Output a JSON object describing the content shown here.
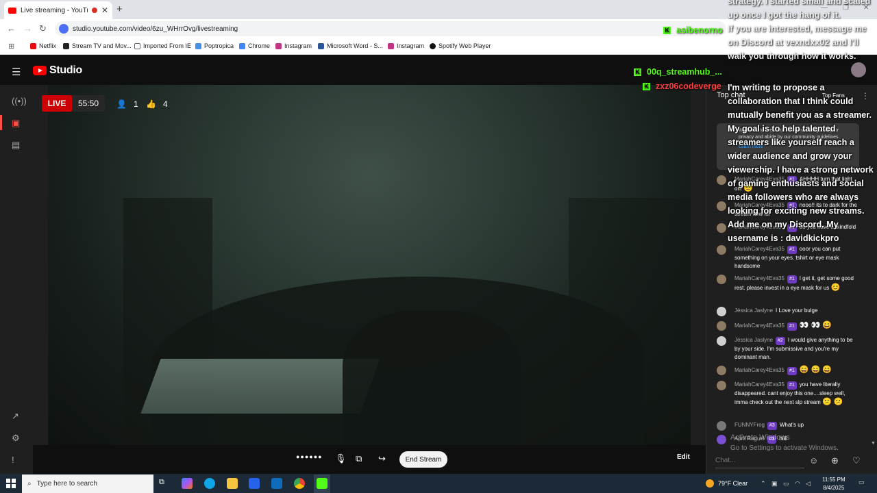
{
  "browser": {
    "tab_title": "Live streaming - YouTube Studio",
    "url": "studio.youtube.com/video/6zu_WHrrOvg/livestreaming",
    "bookmarks": [
      {
        "label": "Netflix",
        "icon": "netflix-icon",
        "color": "#e50914"
      },
      {
        "label": "Stream TV and Mov...",
        "icon": "hulu-icon",
        "color": "#1ce783"
      },
      {
        "label": "Imported From IE",
        "icon": "folder-icon",
        "color": "#5f6368"
      },
      {
        "label": "Poptropica",
        "icon": "poptropica-icon",
        "color": "#4a90e2"
      },
      {
        "label": "Chrome",
        "icon": "google-icon",
        "color": "#4285f4"
      },
      {
        "label": "Instagram",
        "icon": "instagram-icon",
        "color": "#c13584"
      },
      {
        "label": "Microsoft Word - S...",
        "icon": "word-icon",
        "color": "#2b579a"
      },
      {
        "label": "Instagram",
        "icon": "instagram-icon",
        "color": "#c13584"
      },
      {
        "label": "Spotify Web Player",
        "icon": "spotify-icon",
        "color": "#1db954"
      }
    ]
  },
  "studio": {
    "logo_text": "Studio",
    "live_label": "LIVE",
    "elapsed": "55:50",
    "viewers": "1",
    "likes": "4",
    "end_stream_label": "End Stream",
    "edit_label": "Edit",
    "dots": "●●●●●●"
  },
  "overlay": {
    "kick_header_users": [
      {
        "name": "asibenorno",
        "color": "#53fc18"
      },
      {
        "name": "00q_streamhub_...",
        "color": "#53fc18"
      },
      {
        "name": "zxz06codeverge",
        "color": "#ff3b3b"
      }
    ],
    "top_text_lines": [
      "strategy. I started small and scaled",
      "up once I got the hang of it.",
      "If you are interested, message me",
      "on Discord at vexndxx02 and I'll",
      "walk you through how it works."
    ],
    "message": "I'm writing to propose a collaboration that I think could mutually benefit you as a streamer. My goal is to help talented streamers like yourself reach a wider audience and grow your viewership. I have a strong network of gaming enthusiasts and social media followers who are always looking for exciting new streams. Add me on my Discord. My username is : davidkickpro"
  },
  "chat": {
    "mode_label": "Top chat",
    "top_fans_label": "Top Fans",
    "welcome": "Welcome to live chat! Remember to guard your privacy and abide by our community guidelines.",
    "learn_more": "Learn more",
    "messages": [
      {
        "name": "MariahCarey4Eva35",
        "badge": "#1",
        "text": "AHHHH turn that light on!",
        "emoji": "😑"
      },
      {
        "name": "MariahCarey4Eva35",
        "badge": "#1",
        "text": "nooo!! its to dark for the stream now lol",
        "emoji": ""
      },
      {
        "name": "MariahCarey4Eva35",
        "badge": "#1",
        "text": "do you have a blindfold",
        "emoji": ""
      },
      {
        "name": "MariahCarey4Eva35",
        "badge": "#1",
        "text": "ooor you can put something on your eyes. tshirt or eye mask handsome",
        "emoji": ""
      },
      {
        "name": "MariahCarey4Eva35",
        "badge": "#1",
        "text": "I get it, get some good rest. please invest in a eye mask for us",
        "emoji": "😊"
      },
      {
        "name": "Jéssica Jaslyne",
        "badge": "",
        "text": "I Love your bulge",
        "emoji": ""
      },
      {
        "name": "MariahCarey4Eva35",
        "badge": "#1",
        "text": "",
        "emoji": "👀 👀 😄"
      },
      {
        "name": "Jéssica Jaslyne",
        "badge": "#2",
        "text": "I would give anything to be by your side. I'm submissive and you're my dominant man.",
        "emoji": ""
      },
      {
        "name": "MariahCarey4Eva35",
        "badge": "#1",
        "text": "",
        "emoji": "😄 😄 😄"
      },
      {
        "name": "MariahCarey4Eva35",
        "badge": "#1",
        "text": "you have literally disappeared. cant enjoy this one....sleep well, imma check out the next slp stream",
        "emoji": "😕 😕"
      },
      {
        "name": "FUNNYFrog",
        "badge": "#3",
        "text": "What's up",
        "emoji": ""
      },
      {
        "name": "April Raguel",
        "badge": "#3",
        "text": "hiiii",
        "emoji": ""
      }
    ],
    "input_placeholder": "Chat..."
  },
  "windows": {
    "watermark_title": "Activate Windows",
    "watermark_sub": "Go to Settings to activate Windows.",
    "search_placeholder": "Type here to search",
    "weather": "79°F  Clear",
    "time": "11:55 PM",
    "date": "8/4/2025"
  }
}
